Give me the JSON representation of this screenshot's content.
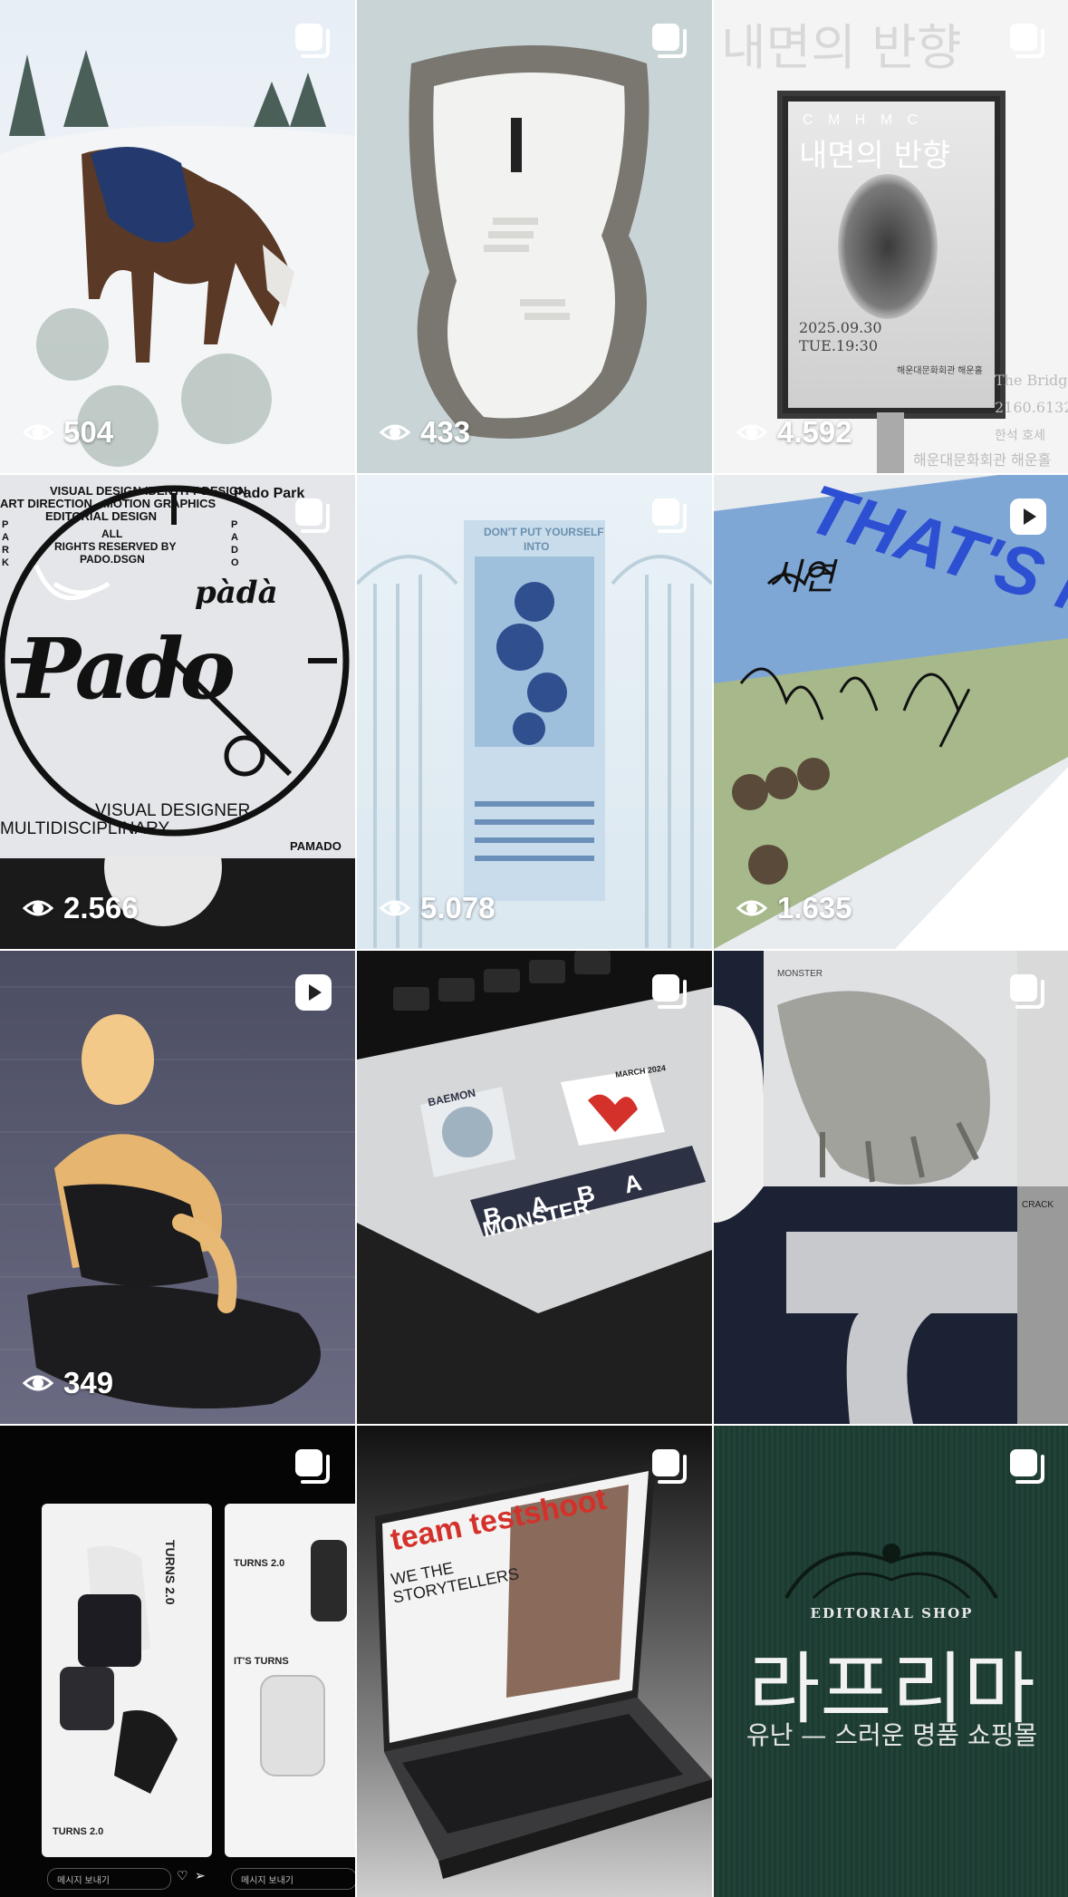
{
  "grid": {
    "tiles": [
      {
        "id": "horse-snow",
        "type": "carousel",
        "views": "504"
      },
      {
        "id": "stairs-crater",
        "type": "carousel",
        "views": "433"
      },
      {
        "id": "poster-billboard",
        "type": "carousel",
        "views": "4.592",
        "texts": {
          "kr_top": "내면의 반향",
          "letters": "C M H M C",
          "kr_title": "내면의 반향",
          "date": "2025.09.30",
          "time": "TUE.19:30",
          "venue": "해운대문화회관 해운홀",
          "side_en": "The Bridge",
          "phone": "2160.6132",
          "kr_bottom": "해운대문화회관 해운홀",
          "side_kr": "한석 호세"
        }
      },
      {
        "id": "pado-poster",
        "type": "carousel",
        "views": "2.566",
        "texts": {
          "visual_design": "VISUAL DESIGN",
          "identity_design": "IDENTITY DESIGN",
          "pado_park": "Pado Park",
          "art_direction": "ART DIRECTION",
          "motion_graphics": "MOTION GRAPHICS",
          "editorial_design": "EDITORIAL DESIGN",
          "all": "ALL",
          "rights": "RIGHTS RESERVED BY",
          "handle": "PADO.DSGN",
          "left_vertical": "P A R K",
          "right_vertical": "P A D O",
          "script_logo": "Pado",
          "small_logo": "pàdà",
          "visual_designer": "VISUAL DESIGNER",
          "multidisciplinary": "MULTIDISCIPLINARY",
          "brand_bottom": "PAMADO"
        }
      },
      {
        "id": "calendar-poster",
        "type": "carousel",
        "views": "5.078",
        "texts": {
          "headline": "DON'T PUT YOURSELF",
          "headline2": "INTO"
        }
      },
      {
        "id": "thats-me-photo",
        "type": "reel",
        "views": "1.635",
        "texts": {
          "banner": "THAT'S ME",
          "handwriting": "시연"
        }
      },
      {
        "id": "dancer-glow",
        "type": "reel",
        "views": "349"
      },
      {
        "id": "laptop-stickers",
        "type": "carousel",
        "views": "",
        "texts": {
          "sticker1": "BAEMON",
          "sticker2": "B A B A",
          "sticker3": "MONSTER",
          "sticker_date": "MARCH 2024"
        }
      },
      {
        "id": "monster-claw",
        "type": "carousel",
        "views": "",
        "texts": {
          "label_top": "MONSTER",
          "label_bottom": "CRACK"
        }
      },
      {
        "id": "turns-backpack",
        "type": "carousel",
        "views": "",
        "texts": {
          "turns1": "TURNS 2.0",
          "turns2": "TURNS 2.0",
          "its_turns": "IT'S TURNS",
          "message": "메시지 보내기"
        }
      },
      {
        "id": "team-testshoot-laptop",
        "type": "carousel",
        "views": "",
        "texts": {
          "title": "team testshoot",
          "subtitle1": "WE THE",
          "subtitle2": "STORYTELLERS"
        }
      },
      {
        "id": "editorial-shop",
        "type": "carousel",
        "views": "",
        "texts": {
          "small": "EDITORIAL SHOP",
          "title": "라프리마",
          "subtitle": "유난 — 스러운 명품 쇼핑몰"
        }
      }
    ]
  },
  "icons": {
    "carousel": "carousel-icon",
    "reel": "reel-icon",
    "views": "eye-icon"
  },
  "colors": {
    "overlay_white": "#ffffff",
    "editorial_green": "#1f3d30",
    "testshoot_red": "#d4312a",
    "thatsme_blue": "#2d4fd1"
  }
}
